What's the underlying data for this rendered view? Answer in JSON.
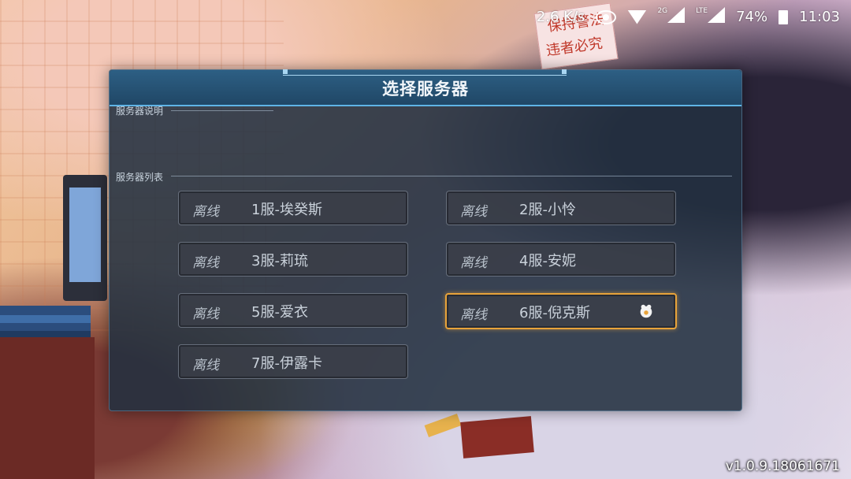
{
  "status_bar": {
    "net_speed": "2.6 K/s",
    "net_2g": "2G",
    "net_lte": "LTE",
    "battery": "74%",
    "time": "11:03"
  },
  "dialog": {
    "title": "选择服务器",
    "description_label": "服务器说明",
    "list_label": "服务器列表"
  },
  "servers": [
    {
      "status": "离线",
      "name": "1服-埃癸斯"
    },
    {
      "status": "离线",
      "name": "2服-小怜"
    },
    {
      "status": "离线",
      "name": "3服-莉琉"
    },
    {
      "status": "离线",
      "name": "4服-安妮"
    },
    {
      "status": "离线",
      "name": "5服-爱衣"
    },
    {
      "status": "离线",
      "name": "6服-倪克斯",
      "selected": true
    },
    {
      "status": "离线",
      "name": "7服-伊露卡"
    }
  ],
  "background_note": [
    "保持警法",
    "违者必究"
  ],
  "version": "v1.0.9.18061671",
  "colors": {
    "selected_border": "#e8a33a",
    "header": "#2d5f84",
    "accent_line": "#5fb4e6"
  }
}
